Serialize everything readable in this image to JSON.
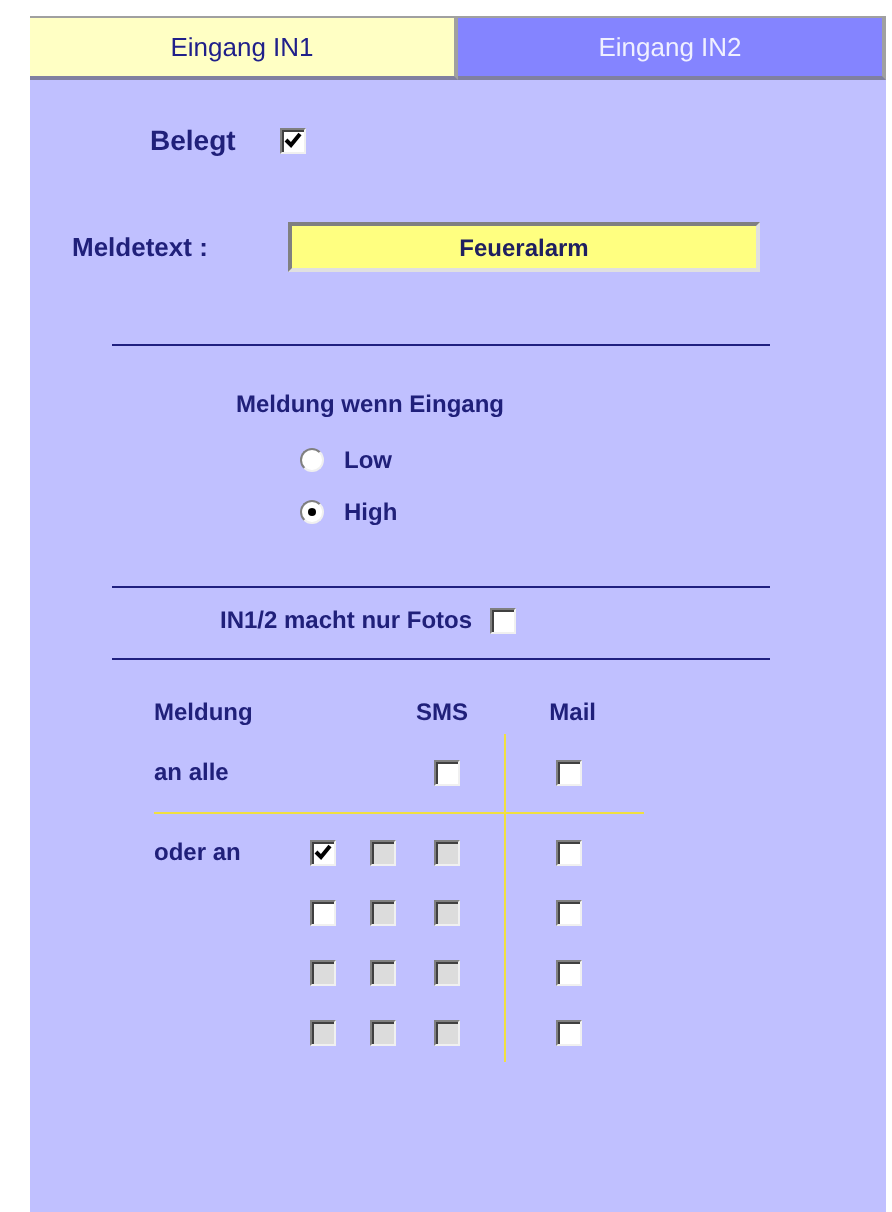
{
  "tabs": [
    {
      "label": "Eingang IN1",
      "selected": true
    },
    {
      "label": "Eingang IN2",
      "selected": false
    }
  ],
  "belegt": {
    "label": "Belegt",
    "checked": true
  },
  "meldetext": {
    "label": "Meldetext :",
    "value": "Feueralarm"
  },
  "trigger": {
    "title": "Meldung wenn Eingang",
    "options": [
      {
        "label": "Low",
        "selected": false
      },
      {
        "label": "High",
        "selected": true
      }
    ]
  },
  "photos_only": {
    "label": "IN1/2 macht nur Fotos",
    "checked": false
  },
  "recipients": {
    "columns": [
      "Meldung",
      "SMS",
      "Mail"
    ],
    "all": {
      "label": "an alle",
      "sms": {
        "checked": false,
        "disabled": false
      },
      "mail": {
        "checked": false,
        "disabled": false
      }
    },
    "rows": [
      {
        "label": "oder an",
        "sms": [
          {
            "checked": true,
            "disabled": false
          },
          {
            "checked": false,
            "disabled": true
          },
          {
            "checked": false,
            "disabled": true
          }
        ],
        "mail": {
          "checked": false,
          "disabled": false
        }
      },
      {
        "sms": [
          {
            "checked": false,
            "disabled": false
          },
          {
            "checked": false,
            "disabled": true
          },
          {
            "checked": false,
            "disabled": true
          }
        ],
        "mail": {
          "checked": false,
          "disabled": false
        }
      },
      {
        "sms": [
          {
            "checked": false,
            "disabled": true
          },
          {
            "checked": false,
            "disabled": true
          },
          {
            "checked": false,
            "disabled": true
          }
        ],
        "mail": {
          "checked": false,
          "disabled": false
        }
      },
      {
        "sms": [
          {
            "checked": false,
            "disabled": true
          },
          {
            "checked": false,
            "disabled": true
          },
          {
            "checked": false,
            "disabled": true
          }
        ],
        "mail": {
          "checked": false,
          "disabled": false
        }
      }
    ]
  }
}
